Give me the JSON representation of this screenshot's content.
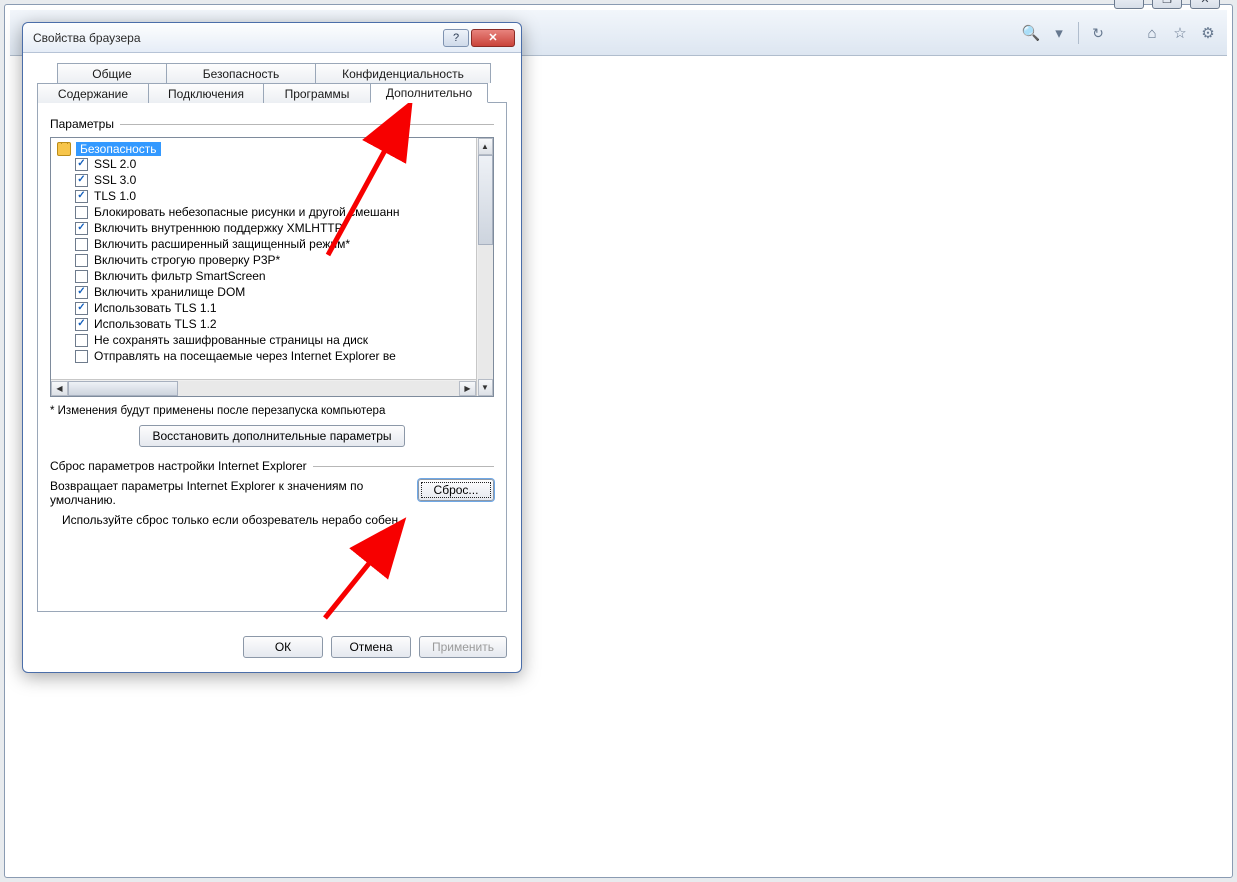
{
  "browserChrome": {
    "winMin": "—",
    "winMax": "❐",
    "winClose": "✕",
    "search": "🔍",
    "dropdown": "▾",
    "refresh": "↻"
  },
  "dialog": {
    "title": "Свойства браузера",
    "help": "?",
    "close": "✕",
    "tabsRow1": {
      "general": "Общие",
      "security": "Безопасность",
      "privacy": "Конфиденциальность"
    },
    "tabsRow2": {
      "content": "Содержание",
      "connections": "Подключения",
      "programs": "Программы",
      "advanced": "Дополнительно"
    },
    "paramsLabel": "Параметры",
    "category": "Безопасность",
    "items": [
      {
        "checked": true,
        "label": "SSL 2.0"
      },
      {
        "checked": true,
        "label": "SSL 3.0"
      },
      {
        "checked": true,
        "label": "TLS 1.0"
      },
      {
        "checked": false,
        "label": "Блокировать небезопасные рисунки и другой смешанн"
      },
      {
        "checked": true,
        "label": "Включить внутреннюю поддержку XMLHTTP"
      },
      {
        "checked": false,
        "label": "Включить расширенный защищенный режим*"
      },
      {
        "checked": false,
        "label": "Включить строгую проверку P3P*"
      },
      {
        "checked": false,
        "label": "Включить фильтр SmartScreen"
      },
      {
        "checked": true,
        "label": "Включить хранилище DOM"
      },
      {
        "checked": true,
        "label": "Использовать TLS 1.1"
      },
      {
        "checked": true,
        "label": "Использовать TLS 1.2"
      },
      {
        "checked": false,
        "label": "Не сохранять зашифрованные страницы на диск"
      },
      {
        "checked": false,
        "label": "Отправлять на посещаемые через Internet Explorer ве"
      }
    ],
    "restartNote": "* Изменения будут применены после перезапуска компьютера",
    "restoreBtn": "Восстановить дополнительные параметры",
    "resetGroup": "Сброс параметров настройки Internet Explorer",
    "resetText": "Возвращает параметры Internet Explorer к значениям по умолчанию.",
    "resetBtn": "Сброс...",
    "resetNote": "Используйте сброс только если обозреватель нерабо          собен.",
    "ok": "ОК",
    "cancel": "Отмена",
    "apply": "Применить"
  }
}
